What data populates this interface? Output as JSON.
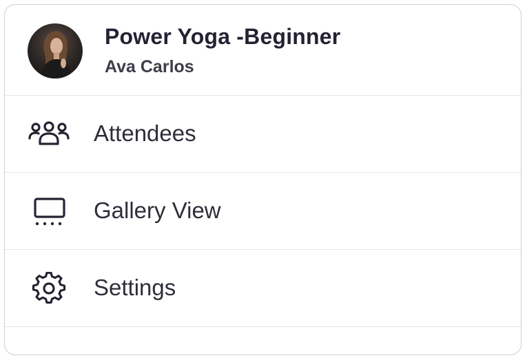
{
  "meeting": {
    "title": "Power Yoga -Beginner",
    "host": "Ava Carlos"
  },
  "menu": {
    "items": [
      {
        "label": "Attendees",
        "icon": "attendees-icon"
      },
      {
        "label": "Gallery View",
        "icon": "gallery-view-icon"
      },
      {
        "label": "Settings",
        "icon": "gear-icon"
      }
    ]
  },
  "colors": {
    "text": "#232333",
    "divider": "#e4e4e7",
    "border": "#cfcfd3"
  }
}
